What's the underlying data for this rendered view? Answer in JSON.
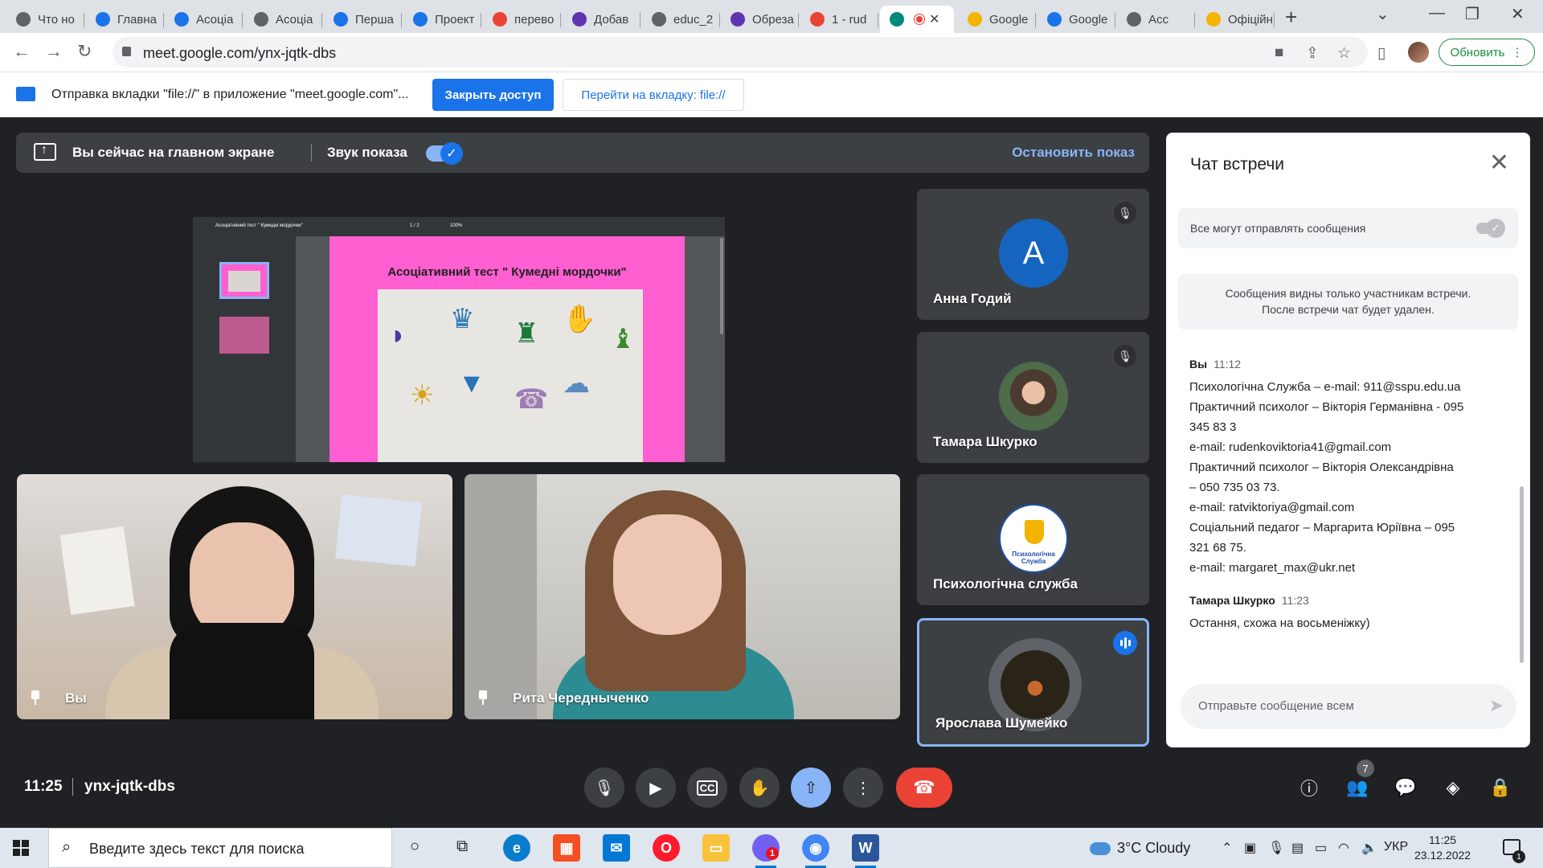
{
  "browser": {
    "tabs": [
      {
        "label": "Что но",
        "icon": "chrome-icon",
        "color": "#5f6368"
      },
      {
        "label": "Главна",
        "icon": "c-logo-icon",
        "color": "#1a73e8"
      },
      {
        "label": "Асоціа",
        "icon": "c-logo-icon",
        "color": "#1a73e8"
      },
      {
        "label": "Асоціа",
        "icon": "globe-icon",
        "color": "#5f6368"
      },
      {
        "label": "Перша",
        "icon": "c-logo-icon",
        "color": "#1a73e8"
      },
      {
        "label": "Проект",
        "icon": "edu-icon",
        "color": "#1a73e8"
      },
      {
        "label": "перево",
        "icon": "google-icon",
        "color": "#ea4335"
      },
      {
        "label": "Добав",
        "icon": "shield-icon",
        "color": "#5e35b1"
      },
      {
        "label": "educ_2",
        "icon": "globe-icon",
        "color": "#5f6368"
      },
      {
        "label": "Обреза",
        "icon": "shield-icon",
        "color": "#5e35b1"
      },
      {
        "label": "1 - rud",
        "icon": "gmail-icon",
        "color": "#ea4335"
      },
      {
        "label": "",
        "icon": "meet-icon",
        "color": "#00897b",
        "active": true
      },
      {
        "label": "Google",
        "icon": "slides-icon",
        "color": "#f4b400"
      },
      {
        "label": "Google",
        "icon": "calendar-icon",
        "color": "#1a73e8"
      },
      {
        "label": "Асс",
        "icon": "globe-icon",
        "color": "#5f6368"
      },
      {
        "label": "Офіційн",
        "icon": "sspu-icon",
        "color": "#f4b400"
      }
    ],
    "url": "meet.google.com/ynx-jqtk-dbs",
    "update_label": "Обновить",
    "infobar": {
      "message": "Отправка вкладки \"file://\" в приложение \"meet.google.com\"...",
      "stop_label": "Закрыть доступ",
      "goto_label": "Перейти на вкладку: file://"
    }
  },
  "meet": {
    "banner": {
      "presenting_text": "Вы сейчас на главном экране",
      "sound_label": "Звук показа",
      "stop_label": "Остановить показ"
    },
    "shared_doc": {
      "doc_name": "Асоціативний тест \" Кумедні мордочки\"",
      "page_counter": "1 / 2",
      "zoom": "100%",
      "heading": "Асоціативний тест \" Кумедні мордочки\""
    },
    "participants": {
      "me": "Вы",
      "rita": "Рита Чередныченко",
      "anna": "Анна Годий",
      "anna_initial": "A",
      "tamara": "Тамара Шкурко",
      "psy": "Психологічна служба",
      "psy_logo_text": "Психологічна Служба",
      "yaroslava": "Ярослава Шумейко"
    },
    "chat": {
      "title": "Чат встречи",
      "allow_label": "Все могут отправлять сообщения",
      "notice_line1": "Сообщения видны только участникам встречи.",
      "notice_line2": "После встречи чат будет удален.",
      "messages": [
        {
          "author": "Вы",
          "time": "11:12",
          "lines": [
            "Психологічна Служба – e-mail: 911@sspu.edu.ua",
            "Практичний психолог – Вікторія Германівна - 095",
            "345 83 3",
            "e-mail: rudenkoviktoria41@gmail.com",
            "Практичний психолог – Вікторія Олександрівна",
            "– 050 735 03 73.",
            "e-mail: ratviktoriya@gmail.com",
            "Соціальний педагог – Маргарита Юріївна – 095",
            "321 68 75.",
            "e-mail: margaret_max@ukr.net"
          ]
        },
        {
          "author": "Тамара Шкурко",
          "time": "11:23",
          "lines": [
            "Остання, схожа на восьменіжку)"
          ]
        }
      ],
      "input_placeholder": "Отправьте сообщение всем"
    },
    "time": "11:25",
    "meeting_code": "ynx-jqtk-dbs",
    "people_count": "7"
  },
  "taskbar": {
    "search_placeholder": "Введите здесь текст для поиска",
    "weather": "3°C  Cloudy",
    "language": "УКР",
    "time": "11:25",
    "date": "23.12.2022",
    "notification_count": "1",
    "viber_badge": "1"
  }
}
